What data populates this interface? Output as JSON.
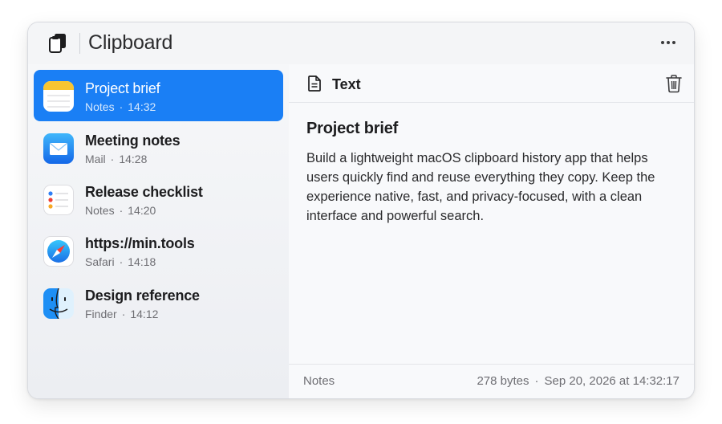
{
  "window": {
    "title": "Clipboard",
    "app_icon": "clipboard-pages-icon",
    "more_icon": "ellipsis-icon"
  },
  "sidebar": {
    "items": [
      {
        "name": "Project brief",
        "app": "Notes",
        "time": "14:32",
        "icon": "notes-app-icon",
        "selected": true
      },
      {
        "name": "Meeting notes",
        "app": "Mail",
        "time": "14:28",
        "icon": "mail-app-icon",
        "selected": false
      },
      {
        "name": "Release checklist",
        "app": "Notes",
        "time": "14:20",
        "icon": "reminders-list-icon",
        "selected": false
      },
      {
        "name": "https://min.tools",
        "app": "Safari",
        "time": "14:18",
        "icon": "safari-app-icon",
        "selected": false
      },
      {
        "name": "Design reference",
        "app": "Finder",
        "time": "14:12",
        "icon": "finder-app-icon",
        "selected": false
      }
    ],
    "separator": "·"
  },
  "detail": {
    "type_label": "Text",
    "type_icon": "document-icon",
    "delete_icon": "trash-icon",
    "title": "Project brief",
    "body": "Build a lightweight macOS clipboard history app that helps users quickly find and reuse everything they copy. Keep the experience native, fast, and privacy-focused, with a clean interface and powerful search.",
    "footer": {
      "app": "Notes",
      "size": "278 bytes",
      "separator": "·",
      "timestamp": "Sep 20, 2026 at 14:32:17"
    }
  },
  "colors": {
    "accent": "#1a7ff5",
    "window_bg": "#f6f7f9",
    "secondary_text": "#6e6e73"
  }
}
